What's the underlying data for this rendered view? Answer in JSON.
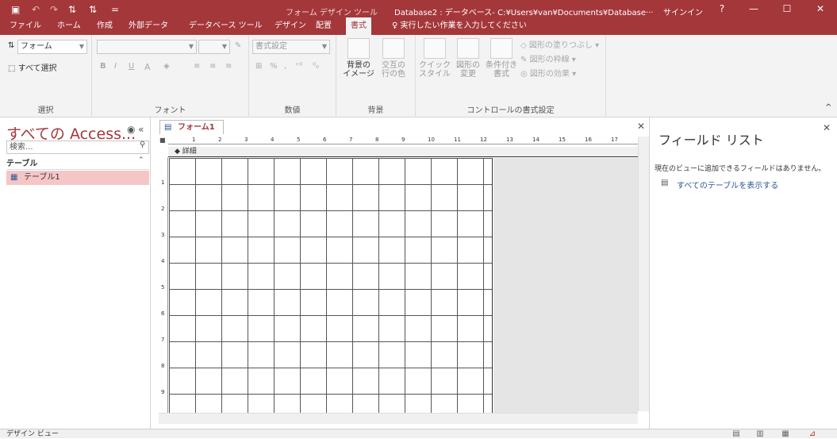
{
  "titlebar": {
    "context_label": "フォーム デザイン ツール",
    "window_title": "Database2 : データベース- C:¥Users¥van¥Documents¥Database···",
    "signin": "サインイン",
    "help": "?",
    "minimize": "—",
    "maximize": "☐",
    "close": "✕"
  },
  "qat": {
    "save": "▣",
    "undo": "↶",
    "redo": "↷",
    "sort_asc": "⇅",
    "sort_desc": "⇅",
    "more": "="
  },
  "tabs": [
    "ファイル",
    "ホーム",
    "作成",
    "外部データ",
    "データベース ツール",
    "デザイン",
    "配置",
    "書式"
  ],
  "tellme": "実行したい作業を入力してください",
  "ribbon": {
    "select_group": {
      "label": "選択",
      "combo": "フォーム",
      "select_all": "すべて選択"
    },
    "font_group": {
      "label": "フォント",
      "bold": "B",
      "italic": "I",
      "underline": "U",
      "fontcolor": "A"
    },
    "number_group": {
      "label": "数値",
      "format_combo": "書式設定",
      "percent": "%",
      "comma": ","
    },
    "background_group": {
      "label": "背景",
      "bg_image": "背景の\nイメージ",
      "alt_color": "交互の\n行の色"
    },
    "control_group": {
      "label": "コントロールの書式設定",
      "quick_style": "クイック\nスタイル",
      "shape_change": "図形の\n変更",
      "conditional": "条件付き\n書式",
      "shape_fill": "図形の塗りつぶし",
      "shape_outline": "図形の枠線",
      "shape_effect": "図形の効果"
    }
  },
  "nav": {
    "title": "すべての Access...",
    "search": "検索...",
    "section": "テーブル",
    "items": [
      {
        "label": "テーブル1"
      }
    ]
  },
  "doc": {
    "tab": "フォーム1",
    "section": "詳細",
    "ruler_numbers": [
      "1",
      "2",
      "3",
      "4",
      "5",
      "6",
      "7",
      "8",
      "9",
      "10",
      "11",
      "12",
      "13",
      "14",
      "15",
      "16",
      "17"
    ],
    "ruler_left": [
      "1",
      "2",
      "3",
      "4",
      "5",
      "6",
      "7",
      "8",
      "9"
    ]
  },
  "field": {
    "title": "フィールド リスト",
    "msg": "現在のビューに追加できるフィールドはありません。",
    "link": "すべてのテーブルを表示する"
  },
  "status": {
    "text": "デザイン ビュー"
  },
  "colors": {
    "brand": "#a4373a",
    "grid": "#555555",
    "selection": "#f6c6c7"
  }
}
